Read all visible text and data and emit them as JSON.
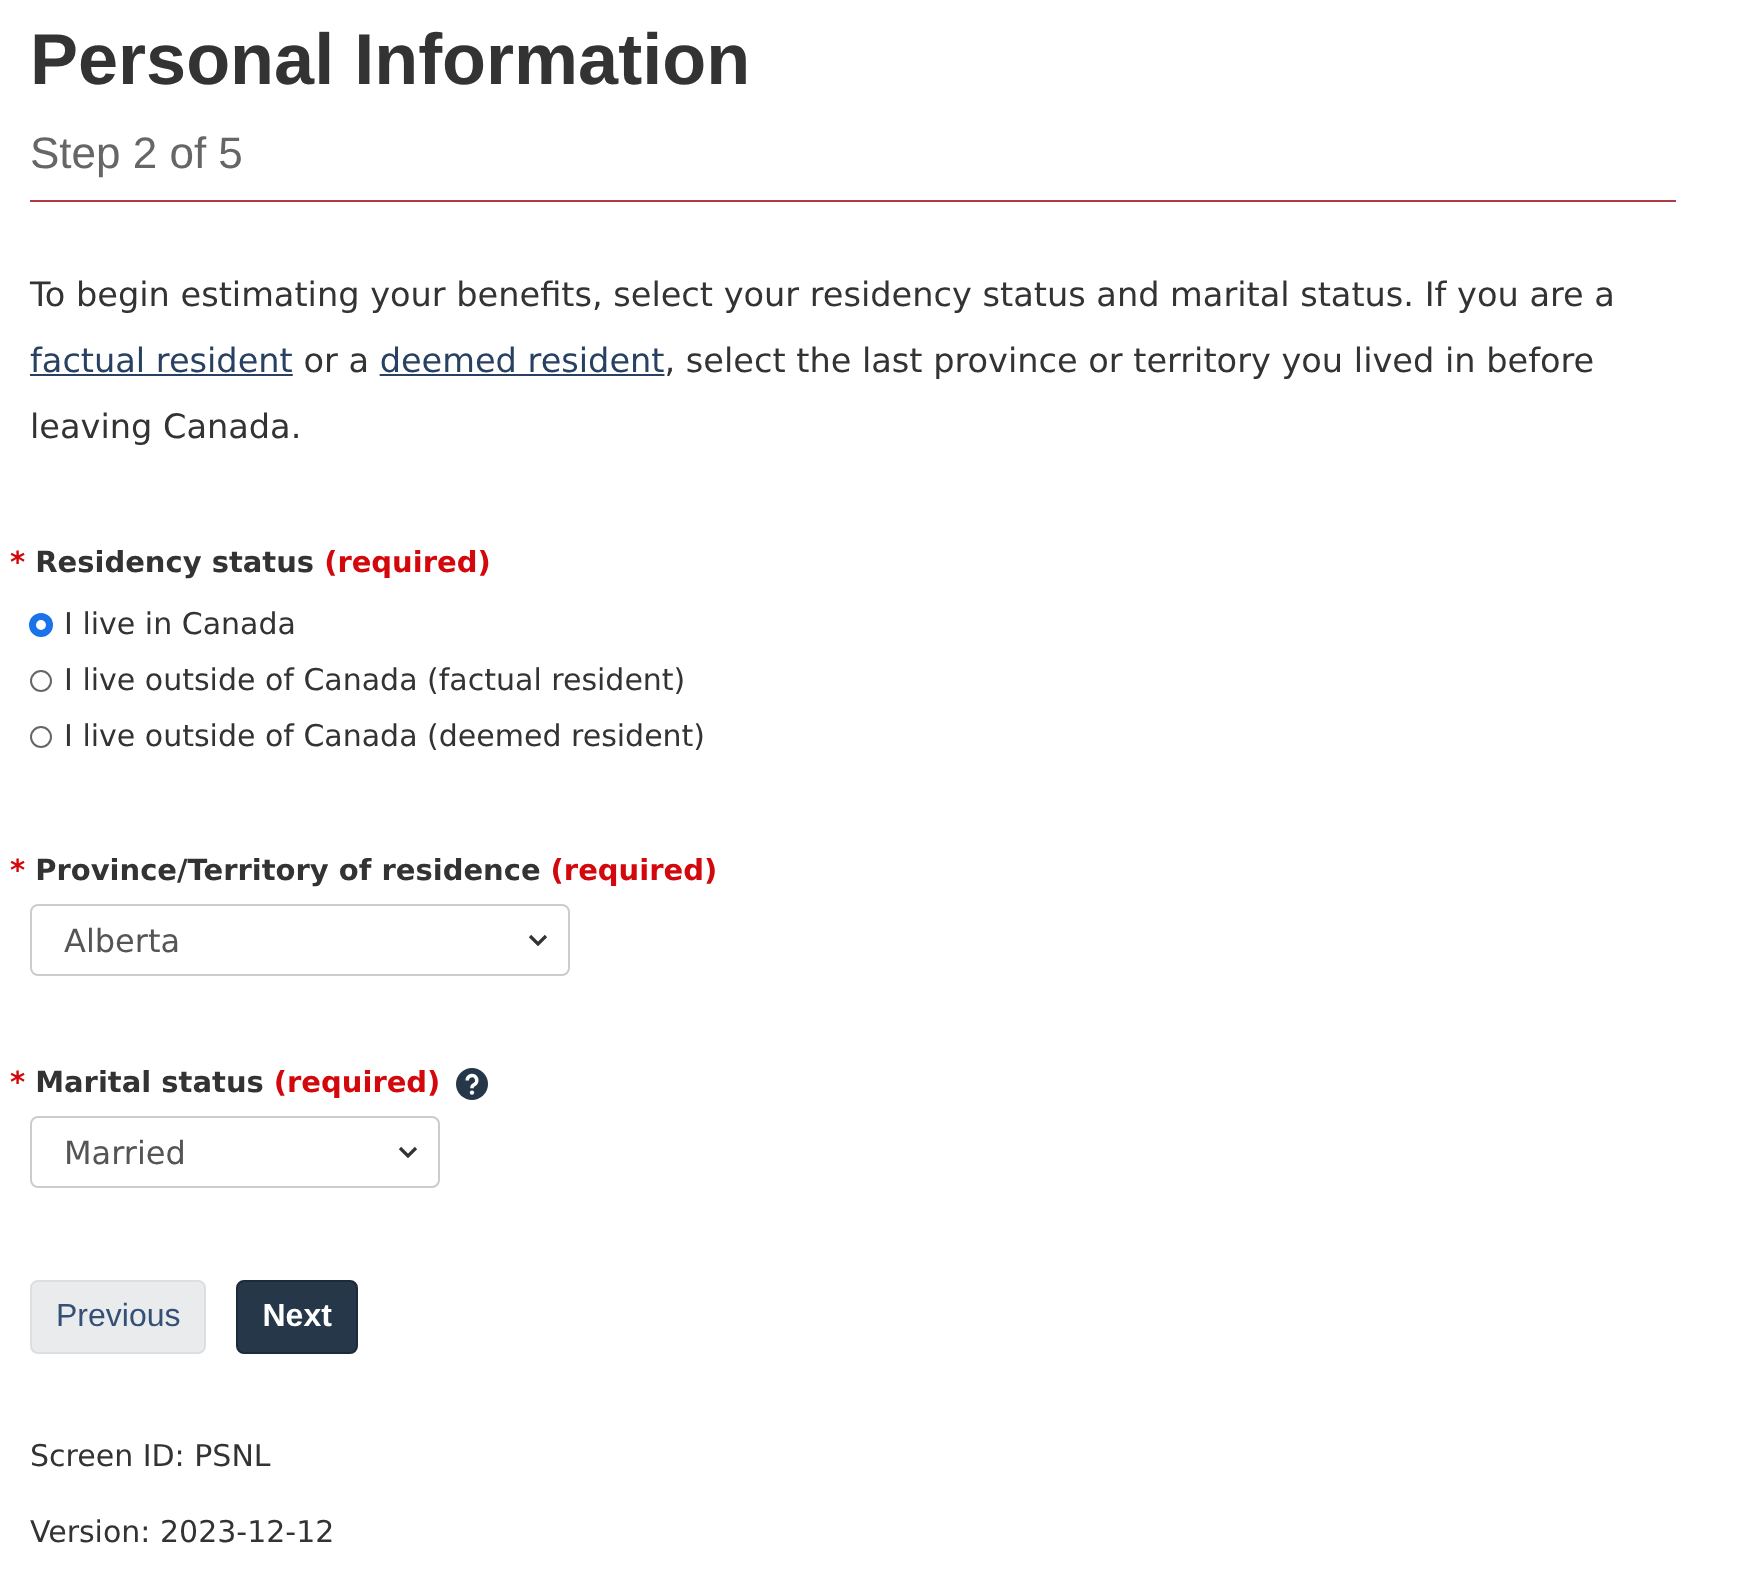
{
  "title": "Personal Information",
  "step": "Step 2 of 5",
  "intro": [
    {
      "kind": "text",
      "text": "To begin estimating your benefits, select your residency status and marital status. If you are a "
    },
    {
      "kind": "link",
      "text": "factual resident"
    },
    {
      "kind": "text",
      "text": " or a "
    },
    {
      "kind": "link",
      "text": "deemed resident"
    },
    {
      "kind": "text",
      "text": ", select the last province or territory you lived in before leaving Canada."
    }
  ],
  "fields": [
    {
      "kind": "radio",
      "marker": "*",
      "label": "Residency status",
      "required": "(required)",
      "help": false,
      "options": [
        {
          "label": "I live in Canada",
          "selected": true
        },
        {
          "label": "I live outside of Canada (factual resident)",
          "selected": false
        },
        {
          "label": "I live outside of Canada (deemed resident)",
          "selected": false
        }
      ]
    },
    {
      "kind": "select",
      "marker": "*",
      "label": "Province/Territory of residence",
      "required": "(required)",
      "help": false,
      "value": "Alberta"
    },
    {
      "kind": "select",
      "marker": "*",
      "label": "Marital status",
      "required": "(required)",
      "help": true,
      "value": "Married"
    }
  ],
  "buttons": [
    {
      "label": "Previous",
      "kind": "secondary"
    },
    {
      "label": "Next",
      "kind": "primary"
    }
  ],
  "footer": [
    "Screen ID: PSNL",
    "Version: 2023-12-12"
  ]
}
